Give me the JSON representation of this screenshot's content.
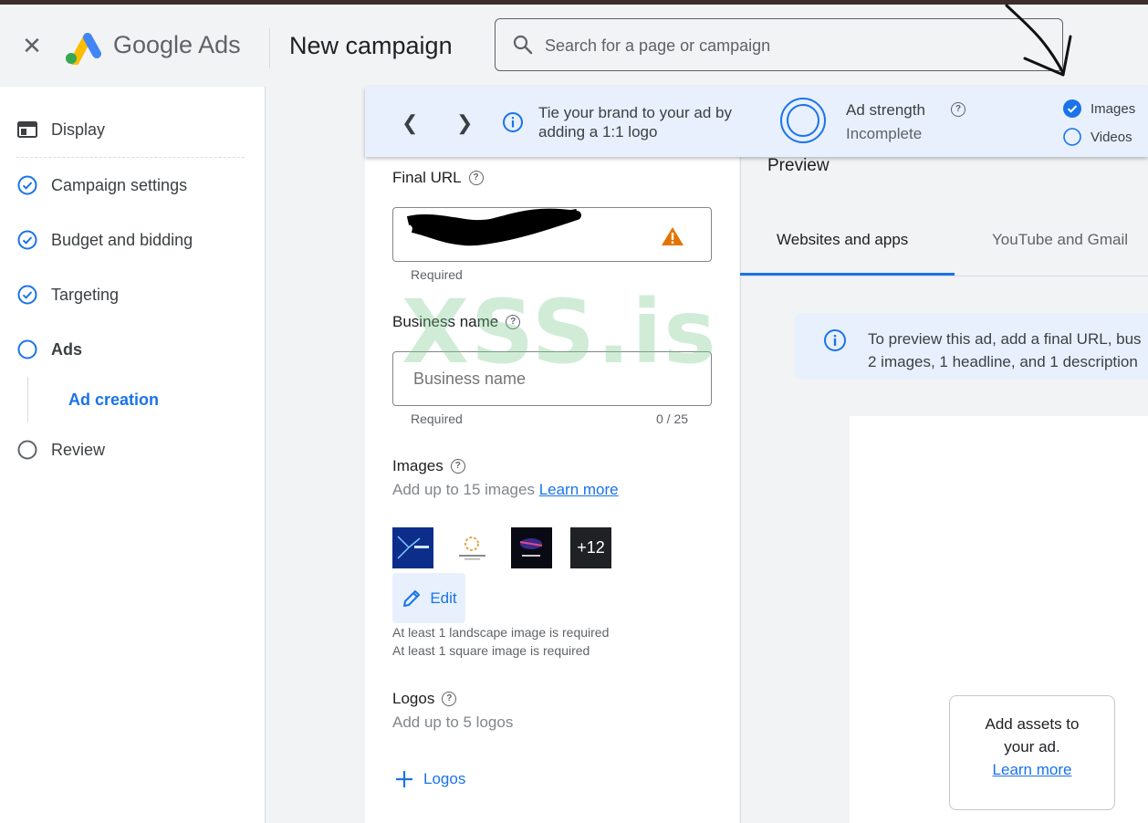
{
  "app": {
    "logo_text": "Google Ads",
    "page_title": "New campaign"
  },
  "search": {
    "placeholder": "Search for a page or campaign"
  },
  "nav": {
    "items": [
      {
        "label": "Display",
        "state": "section"
      },
      {
        "label": "Campaign settings",
        "state": "done"
      },
      {
        "label": "Budget and bidding",
        "state": "done"
      },
      {
        "label": "Targeting",
        "state": "done"
      },
      {
        "label": "Ads",
        "state": "current"
      },
      {
        "label": "Review",
        "state": "todo"
      }
    ],
    "sub_item": "Ad creation"
  },
  "banner": {
    "tip": "Tie your brand to your ad by adding a 1:1 logo",
    "strength_title": "Ad strength",
    "strength_status": "Incomplete",
    "options": [
      {
        "label": "Images",
        "checked": true
      },
      {
        "label": "Videos",
        "checked": false
      }
    ]
  },
  "form": {
    "final_url": {
      "label": "Final URL",
      "hint": "Required"
    },
    "business_name": {
      "label": "Business name",
      "placeholder": "Business name",
      "hint": "Required",
      "counter": "0 / 25"
    },
    "images": {
      "label": "Images",
      "subtitle": "Add up to 15 images",
      "learn_more": "Learn more",
      "more_count": "+12",
      "edit_label": "Edit",
      "requirements": [
        "At least 1 landscape image is required",
        "At least 1 square image is required"
      ]
    },
    "logos": {
      "label": "Logos",
      "subtitle": "Add up to 5 logos",
      "add_label": "Logos"
    }
  },
  "preview": {
    "title": "Preview",
    "tabs": [
      "Websites and apps",
      "YouTube and Gmail"
    ],
    "active_tab": 0,
    "info_line1": "To preview this ad, add a final URL, bus",
    "info_line2": "2 images, 1 headline, and 1 description",
    "card_text_1": "Add assets to",
    "card_text_2": "your ad.",
    "card_link": "Learn more"
  },
  "watermark": "XSS.is",
  "colors": {
    "accent": "#1a73e8",
    "warning": "#e37400",
    "banner_bg": "#e8f0fe"
  }
}
